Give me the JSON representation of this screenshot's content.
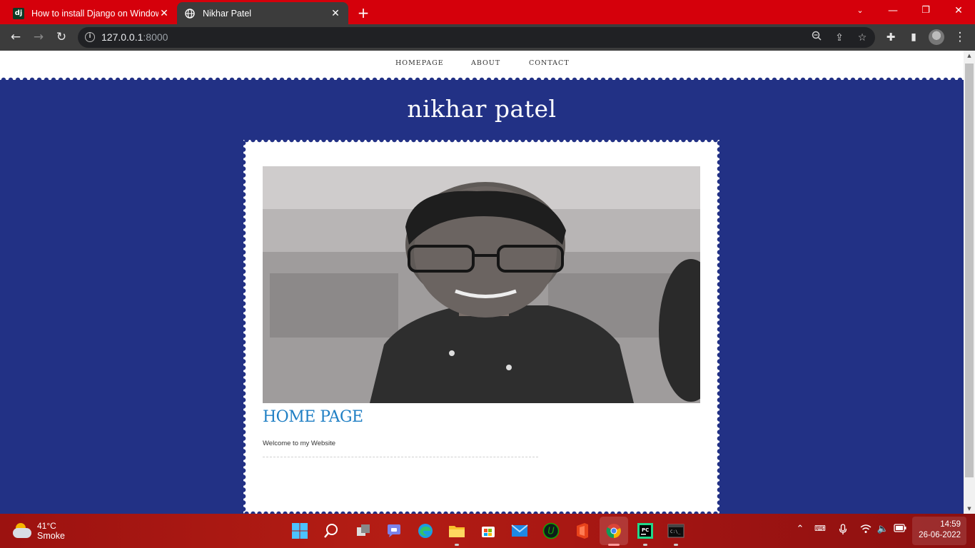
{
  "browser": {
    "tabs": [
      {
        "label": "How to install Django on Windows",
        "favicon": "dj",
        "active": false
      },
      {
        "label": "Nikhar Patel",
        "favicon": "globe-icon",
        "active": true
      }
    ],
    "new_tab": "+",
    "url_host": "127.0.0.1",
    "url_port": ":8000",
    "accent": "#d5000b"
  },
  "page": {
    "nav": [
      "HOMEPAGE",
      "ABOUT",
      "CONTACT"
    ],
    "site_title": "nikhar patel",
    "heading": "HOME PAGE",
    "welcome": "Welcome to my Website",
    "photo_caption": "Portrait photo",
    "background_color": "#223185",
    "heading_color": "#1f7fc4"
  },
  "taskbar": {
    "weather_temp": "41°C",
    "weather_desc": "Smoke",
    "time": "14:59",
    "date": "26-06-2022"
  }
}
